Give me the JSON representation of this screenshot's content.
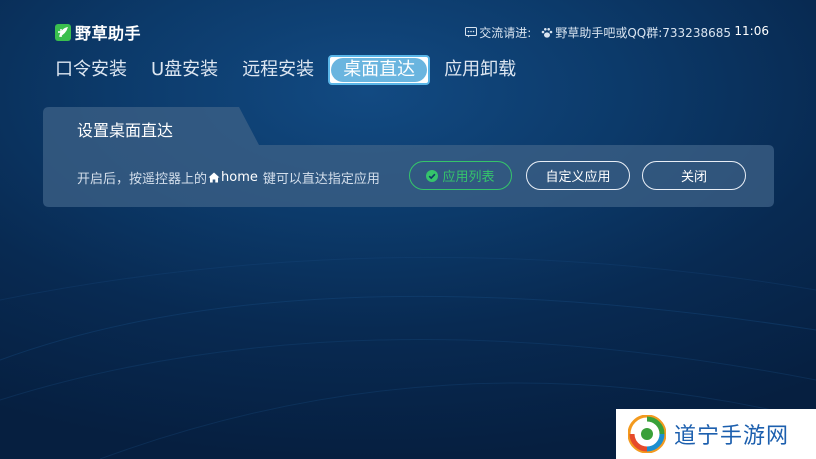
{
  "app": {
    "name": "野草助手"
  },
  "header": {
    "contact_label": "交流请进:",
    "contact_value": "野草助手吧或QQ群:733238685",
    "clock": "11:06"
  },
  "tabs": [
    {
      "label": "口令安装",
      "active": false
    },
    {
      "label": "U盘安装",
      "active": false
    },
    {
      "label": "远程安装",
      "active": false
    },
    {
      "label": "桌面直达",
      "active": true
    },
    {
      "label": "应用卸载",
      "active": false
    }
  ],
  "panel": {
    "title": "设置桌面直达",
    "desc_before": "开启后，按遥控器上的",
    "desc_home": "home",
    "desc_after": "键可以直达指定应用",
    "buttons": {
      "apps": "应用列表",
      "custom": "自定义应用",
      "close": "关闭"
    }
  },
  "watermark": {
    "text": "道宁手游网"
  },
  "colors": {
    "accent_green": "#35c46b",
    "tab_active": "#6ab5df",
    "watermark_blue": "#1c5fae"
  },
  "icons": [
    "leaf-logo-icon",
    "chat-icon",
    "paw-icon",
    "home-icon",
    "check-circle-icon",
    "swirl-logo-icon"
  ]
}
